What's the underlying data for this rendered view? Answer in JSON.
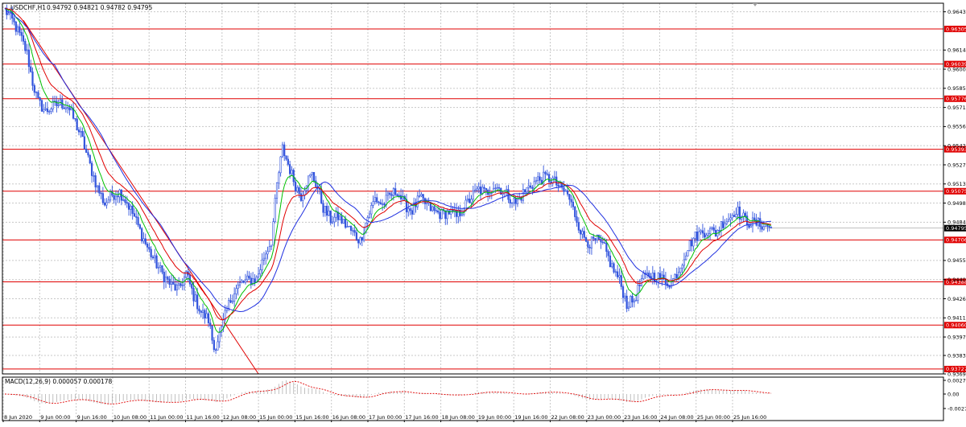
{
  "header": {
    "symbol": "USDCHF,H1",
    "ohlc": "0.94792 0.94821 0.94782 0.94795"
  },
  "colors": {
    "background": "#ffffff",
    "grid": "#c8c8c8",
    "candle": "#3355dd",
    "level": "#e00000",
    "ma_fast": "#00c000",
    "ma_mid": "#e00000",
    "ma_slow": "#2030e0",
    "last_price_box": "#000000"
  },
  "chart_data": {
    "type": "candlestick",
    "price_axis": {
      "range": [
        0.9369,
        0.965
      ],
      "ticks": [
        "0.96435",
        "0.96145",
        "0.96000",
        "0.95855",
        "0.95710",
        "0.95565",
        "0.95420",
        "0.95275",
        "0.95130",
        "0.94985",
        "0.94840",
        "0.94550",
        "0.94405",
        "0.94260",
        "0.94115",
        "0.93970",
        "0.93830",
        "0.93690"
      ]
    },
    "time_axis": {
      "ticks": [
        "8 Jun 2020",
        "9 Jun 00:00",
        "9 Jun 16:00",
        "10 Jun 08:00",
        "11 Jun 00:00",
        "11 Jun 16:00",
        "12 Jun 08:00",
        "15 Jun 00:00",
        "15 Jun 16:00",
        "16 Jun 08:00",
        "17 Jun 00:00",
        "17 Jun 16:00",
        "18 Jun 08:00",
        "19 Jun 00:00",
        "19 Jun 16:00",
        "22 Jun 08:00",
        "23 Jun 00:00",
        "23 Jun 16:00",
        "24 Jun 08:00",
        "25 Jun 00:00",
        "25 Jun 16:00"
      ]
    },
    "grid": true,
    "levels": [
      "0.96305",
      "0.96039",
      "0.95776",
      "0.95393",
      "0.95075",
      "0.94706",
      "0.94388",
      "0.94060",
      "0.93727"
    ],
    "last_price": "0.94795",
    "price_path": [
      [
        0,
        0.9645
      ],
      [
        4,
        0.9637
      ],
      [
        8,
        0.9626
      ],
      [
        12,
        0.9612
      ],
      [
        15,
        0.959
      ],
      [
        18,
        0.9575
      ],
      [
        22,
        0.9568
      ],
      [
        26,
        0.9572
      ],
      [
        30,
        0.9574
      ],
      [
        34,
        0.9572
      ],
      [
        38,
        0.956
      ],
      [
        42,
        0.9546
      ],
      [
        46,
        0.9527
      ],
      [
        50,
        0.951
      ],
      [
        54,
        0.9498
      ],
      [
        58,
        0.9505
      ],
      [
        62,
        0.9507
      ],
      [
        66,
        0.9499
      ],
      [
        70,
        0.9488
      ],
      [
        74,
        0.9474
      ],
      [
        78,
        0.9462
      ],
      [
        82,
        0.9452
      ],
      [
        86,
        0.9443
      ],
      [
        90,
        0.9436
      ],
      [
        94,
        0.9433
      ],
      [
        98,
        0.9445
      ],
      [
        102,
        0.9428
      ],
      [
        106,
        0.9416
      ],
      [
        110,
        0.941
      ],
      [
        113,
        0.9388
      ],
      [
        117,
        0.9402
      ],
      [
        120,
        0.9418
      ],
      [
        124,
        0.9432
      ],
      [
        128,
        0.9438
      ],
      [
        132,
        0.944
      ],
      [
        136,
        0.9441
      ],
      [
        140,
        0.9458
      ],
      [
        144,
        0.947
      ],
      [
        147,
        0.9512
      ],
      [
        150,
        0.954
      ],
      [
        153,
        0.9528
      ],
      [
        157,
        0.9512
      ],
      [
        160,
        0.9504
      ],
      [
        163,
        0.9515
      ],
      [
        166,
        0.952
      ],
      [
        169,
        0.951
      ],
      [
        172,
        0.9495
      ],
      [
        176,
        0.9486
      ],
      [
        180,
        0.9488
      ],
      [
        184,
        0.9482
      ],
      [
        188,
        0.9476
      ],
      [
        192,
        0.947
      ],
      [
        196,
        0.9488
      ],
      [
        200,
        0.9502
      ],
      [
        204,
        0.9497
      ],
      [
        208,
        0.9504
      ],
      [
        212,
        0.9508
      ],
      [
        216,
        0.9497
      ],
      [
        220,
        0.9493
      ],
      [
        224,
        0.9502
      ],
      [
        228,
        0.9497
      ],
      [
        232,
        0.9492
      ],
      [
        236,
        0.949
      ],
      [
        240,
        0.9492
      ],
      [
        244,
        0.9488
      ],
      [
        248,
        0.9495
      ],
      [
        252,
        0.9503
      ],
      [
        256,
        0.9509
      ],
      [
        260,
        0.9506
      ],
      [
        264,
        0.9512
      ],
      [
        268,
        0.9509
      ],
      [
        272,
        0.9504
      ],
      [
        276,
        0.9498
      ],
      [
        280,
        0.9506
      ],
      [
        284,
        0.9512
      ],
      [
        288,
        0.9516
      ],
      [
        292,
        0.9518
      ],
      [
        296,
        0.9516
      ],
      [
        300,
        0.951
      ],
      [
        304,
        0.9505
      ],
      [
        308,
        0.949
      ],
      [
        312,
        0.9474
      ],
      [
        316,
        0.9468
      ],
      [
        320,
        0.947
      ],
      [
        324,
        0.9464
      ],
      [
        328,
        0.945
      ],
      [
        332,
        0.944
      ],
      [
        336,
        0.9422
      ],
      [
        340,
        0.9425
      ],
      [
        344,
        0.944
      ],
      [
        348,
        0.9444
      ],
      [
        352,
        0.9443
      ],
      [
        356,
        0.944
      ],
      [
        360,
        0.9438
      ],
      [
        364,
        0.9448
      ],
      [
        368,
        0.9462
      ],
      [
        372,
        0.9472
      ],
      [
        376,
        0.9476
      ],
      [
        380,
        0.9478
      ],
      [
        384,
        0.9476
      ],
      [
        388,
        0.9484
      ],
      [
        392,
        0.9488
      ],
      [
        395,
        0.9494
      ],
      [
        398,
        0.9488
      ],
      [
        402,
        0.9484
      ],
      [
        406,
        0.9483
      ],
      [
        410,
        0.9482
      ],
      [
        414,
        0.948
      ]
    ],
    "moving_averages": [
      "fast",
      "mid",
      "slow"
    ],
    "indicator": {
      "label": "MACD(12,26,9) 0.000057 0.000178",
      "ticks": [
        "0.002749",
        "0.00",
        "-0.00277"
      ]
    }
  }
}
